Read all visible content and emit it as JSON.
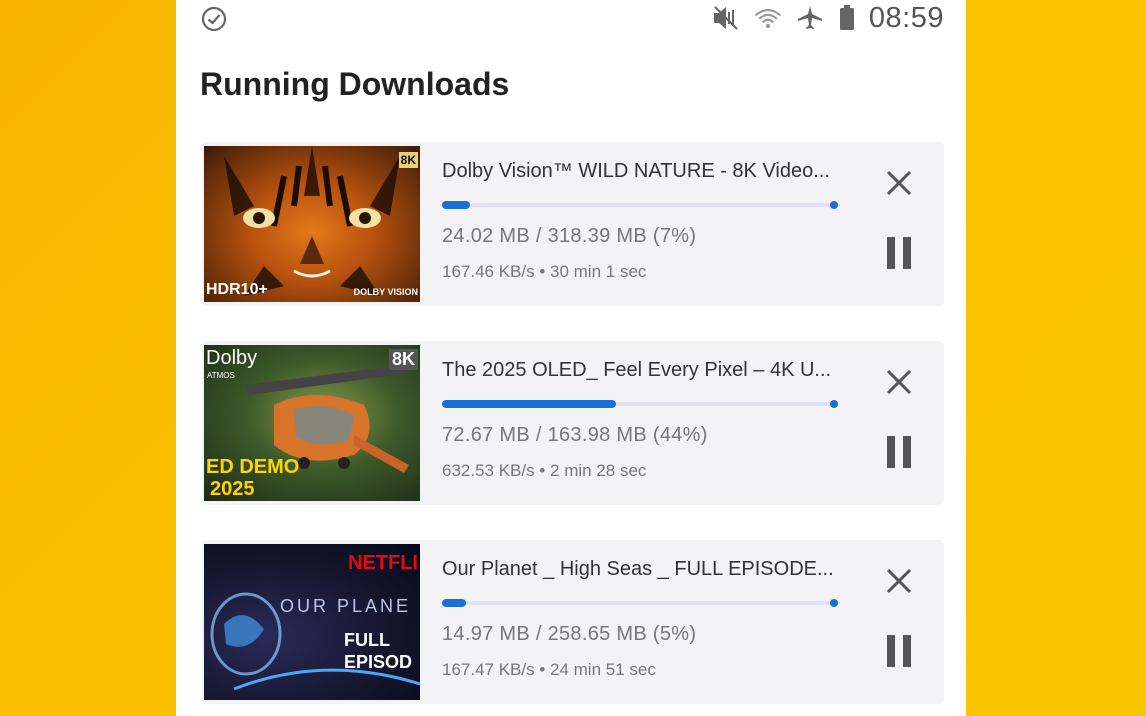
{
  "status_bar": {
    "time": "08:59",
    "icons": [
      "check-circle-icon",
      "mute-icon",
      "wifi-icon",
      "airplane-icon",
      "battery-icon"
    ]
  },
  "page": {
    "title": "Running Downloads"
  },
  "colors": {
    "accent": "#1b6fd6",
    "background": "#fcc200",
    "track": "#e2e0f4"
  },
  "downloads": [
    {
      "title": "Dolby Vision™ WILD NATURE - 8K Video...",
      "size_text": "24.02 MB / 318.39 MB (7%)",
      "speed_text": "167.46 KB/s • 30 min 1 sec",
      "progress": 0.07,
      "thumb": {
        "badge_left": "HDR10+",
        "badge_right": "DOLBY VISION",
        "badge_top": "8K"
      }
    },
    {
      "title": "The 2025 OLED_ Feel Every Pixel – 4K U...",
      "size_text": "72.67 MB / 163.98 MB (44%)",
      "speed_text": "632.53 KB/s • 2 min 28 sec",
      "progress": 0.44,
      "thumb": {
        "badge_left": "Dolby",
        "badge_sub": "ATMOS",
        "badge_top": "8K",
        "caption1": "ED DEMO",
        "caption2": "2025"
      }
    },
    {
      "title": "Our Planet _ High Seas _ FULL EPISODE...",
      "size_text": "14.97 MB / 258.65 MB (5%)",
      "speed_text": "167.47 KB/s • 24 min 51 sec",
      "progress": 0.05,
      "thumb": {
        "badge_top": "NETFLI",
        "caption1": "OUR PLANE",
        "caption2": "FULL",
        "caption3": "EPISOD"
      }
    }
  ]
}
